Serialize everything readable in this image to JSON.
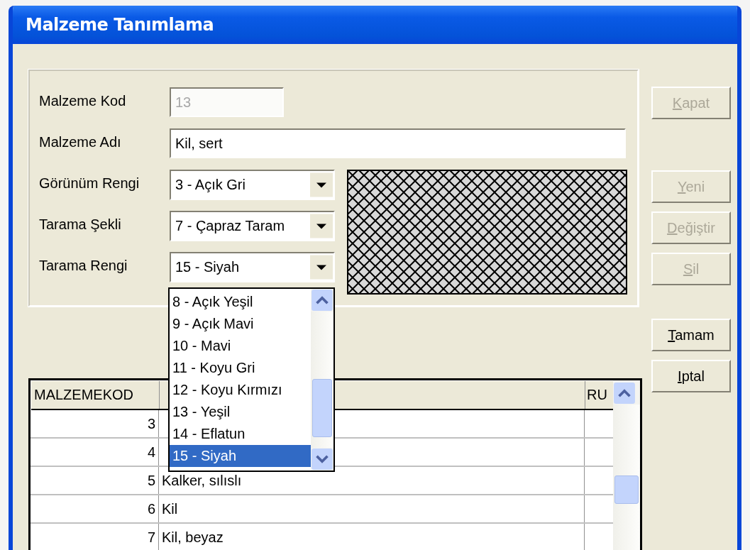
{
  "window": {
    "title": "Malzeme Tanımlama"
  },
  "form": {
    "fields": [
      {
        "kind": "text",
        "label": "Malzeme Kod",
        "value": "13",
        "disabled": true
      },
      {
        "kind": "text",
        "label": "Malzeme Adı",
        "value": "Kil, sert",
        "disabled": false
      },
      {
        "kind": "combo",
        "label": "Görünüm Rengi",
        "value": "3 - Açık Gri"
      },
      {
        "kind": "combo",
        "label": "Tarama Şekli",
        "value": "7 - Çapraz Taram"
      },
      {
        "kind": "combo",
        "label": "Tarama Rengi",
        "value": "15 - Siyah",
        "options": [
          {
            "label": "8 - Açık Yeşil",
            "selected": false
          },
          {
            "label": "9 - Açık Mavi",
            "selected": false
          },
          {
            "label": "10 - Mavi",
            "selected": false
          },
          {
            "label": "11 - Koyu Gri",
            "selected": false
          },
          {
            "label": "12 - Koyu Kırmızı",
            "selected": false
          },
          {
            "label": "13 - Yeşil",
            "selected": false
          },
          {
            "label": "14 - Eflatun",
            "selected": false
          },
          {
            "label": "15 - Siyah",
            "selected": true
          }
        ]
      }
    ]
  },
  "top_buttons": [
    {
      "label": "Kapat",
      "disabled": true
    }
  ],
  "edit_buttons": [
    {
      "label": "Yeni",
      "disabled": true
    },
    {
      "label": "Değiştir",
      "disabled": true
    },
    {
      "label": "Sil",
      "disabled": true
    }
  ],
  "dialog_buttons": [
    {
      "label": "Tamam",
      "disabled": false
    },
    {
      "label": "Iptal",
      "disabled": false
    }
  ],
  "table": {
    "column_1": "MALZEMEKOD",
    "column_3": "RU",
    "rows": [
      {
        "code": "3"
      },
      {
        "code": "4"
      },
      {
        "code": "5",
        "name": "Kalker, sılıslı"
      },
      {
        "code": "6",
        "name": "Kil"
      },
      {
        "code": "7",
        "name": "Kil, beyaz"
      }
    ]
  }
}
